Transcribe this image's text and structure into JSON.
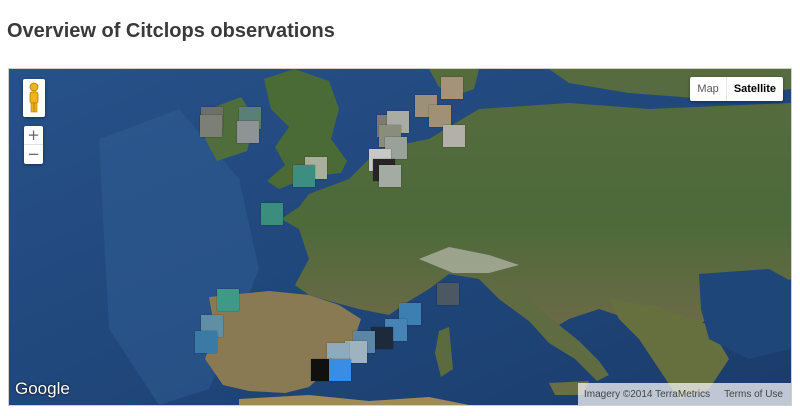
{
  "page": {
    "title": "Overview of Citclops observations"
  },
  "map": {
    "type_controls": {
      "map_label": "Map",
      "satellite_label": "Satellite",
      "selected": "Satellite"
    },
    "zoom": {
      "in_label": "+",
      "out_label": "−"
    },
    "logo": "Google",
    "imagery_credit": "Imagery ©2014 TerraMetrics",
    "terms_label": "Terms of Use",
    "region": "Europe",
    "view": "satellite"
  },
  "observation_markers": {
    "count": 30,
    "colors": {
      "sea_green": "#3f9a8a",
      "sea_blue": "#3b78b8",
      "sky_grey": "#a7b0b3",
      "sand": "#a08f7a",
      "dark": "#1a1a1a",
      "bright_blue": "#3a8de6"
    }
  }
}
